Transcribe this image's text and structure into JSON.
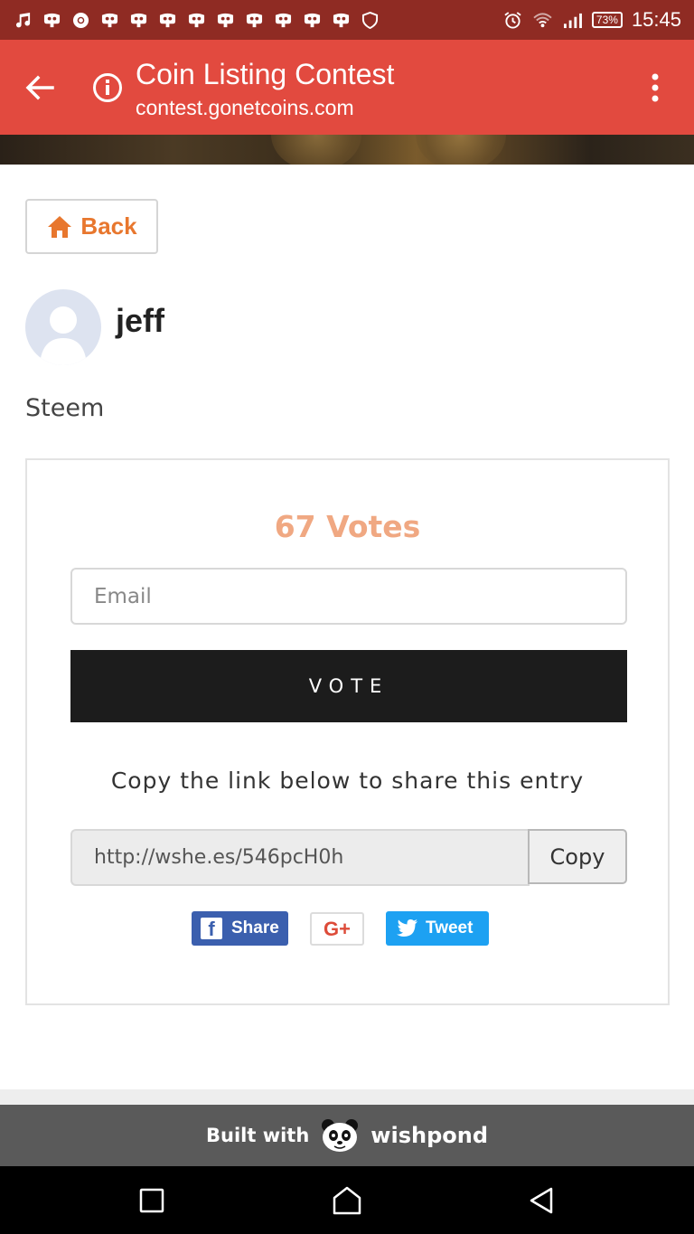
{
  "status_bar": {
    "time": "15:45",
    "battery": "73%",
    "icons": [
      "music-note-icon",
      "notification-icon",
      "chrome-icon",
      "notification-icon",
      "notification-icon",
      "notification-icon",
      "notification-icon",
      "notification-icon",
      "notification-icon",
      "notification-icon",
      "notification-icon",
      "notification-icon",
      "shield-icon",
      "alarm-icon",
      "wifi-icon",
      "signal-icon"
    ]
  },
  "toolbar": {
    "title": "Coin Listing Contest",
    "url": "contest.gonetcoins.com"
  },
  "page": {
    "back_label": "Back",
    "username": "jeff",
    "entry_text": "Steem",
    "votes": "67 Votes",
    "email_placeholder": "Email",
    "vote_label": "VOTE",
    "share_caption": "Copy the link below to share this entry",
    "share_link": "http://wshe.es/546pcH0h",
    "copy_label": "Copy",
    "fb_label": "Share",
    "gplus_label": "G+",
    "tweet_label": "Tweet"
  },
  "footer": {
    "built_with": "Built with",
    "brand": "wishpond"
  },
  "colors": {
    "status_bar": "#8f2b23",
    "toolbar": "#e24a3f",
    "accent_orange": "#e8772e",
    "votes": "#f0a882",
    "vote_button": "#1c1c1c",
    "facebook": "#3b5fae",
    "twitter": "#1da1f2",
    "gplus": "#dd4b39",
    "footer": "#5a5a5a"
  }
}
